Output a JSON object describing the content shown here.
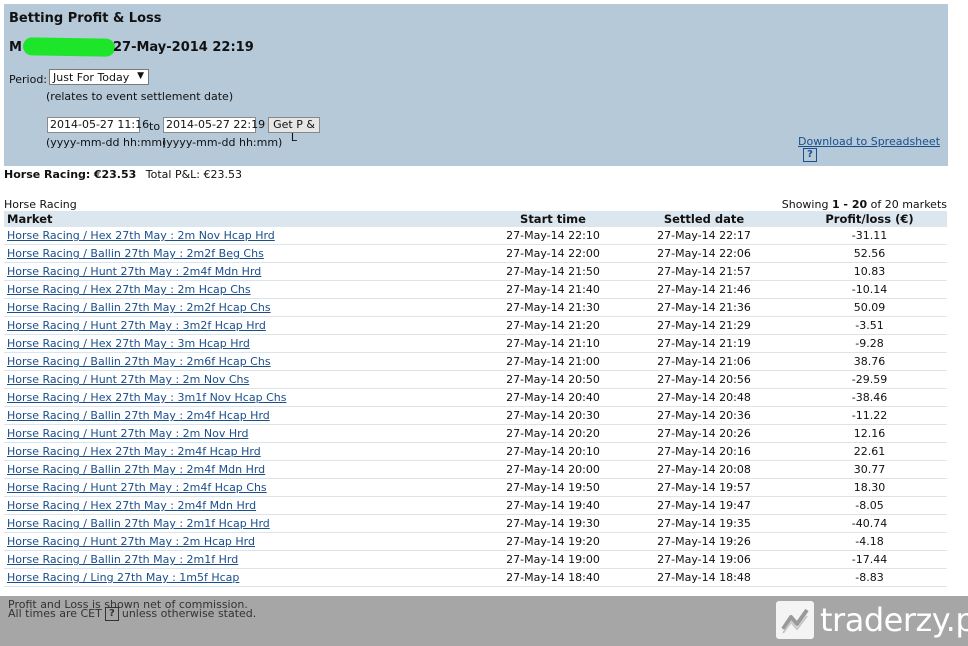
{
  "header": {
    "title": "Betting Profit & Loss",
    "account_prefix": "M",
    "account_timestamp": "27-May-2014 22:19",
    "period_label": "Period:",
    "period_value": "Just For Today",
    "period_note": "(relates to event settlement date)",
    "date_from": "2014-05-27 11:16",
    "to_label": "to",
    "date_to": "2014-05-27 22:19",
    "get_button": "Get P & L",
    "format_hint_from": "(yyyy-mm-dd hh:mm)",
    "format_hint_to": "(yyyy-mm-dd hh:mm)",
    "download_link": "Download to Spreadsheet",
    "help_mark": "?"
  },
  "summary": {
    "sport_label": "Horse Racing:",
    "sport_amount": "€23.53",
    "total_label": "Total P&L:",
    "total_amount": "€23.53"
  },
  "list": {
    "section": "Horse Racing",
    "showing_prefix": "Showing",
    "showing_range": "1 - 20",
    "showing_suffix": "of 20 markets",
    "columns": [
      "Market",
      "Start time",
      "Settled date",
      "Profit/loss (€)"
    ],
    "rows": [
      {
        "market": "Horse Racing / Hex 27th May : 2m Nov Hcap Hrd",
        "start": "27-May-14 22:10",
        "settled": "27-May-14 22:17",
        "pl": "-31.11"
      },
      {
        "market": "Horse Racing / Ballin 27th May : 2m2f Beg Chs",
        "start": "27-May-14 22:00",
        "settled": "27-May-14 22:06",
        "pl": "52.56"
      },
      {
        "market": "Horse Racing / Hunt 27th May : 2m4f Mdn Hrd",
        "start": "27-May-14 21:50",
        "settled": "27-May-14 21:57",
        "pl": "10.83"
      },
      {
        "market": "Horse Racing / Hex 27th May : 2m Hcap Chs",
        "start": "27-May-14 21:40",
        "settled": "27-May-14 21:46",
        "pl": "-10.14"
      },
      {
        "market": "Horse Racing / Ballin 27th May : 2m2f Hcap Chs",
        "start": "27-May-14 21:30",
        "settled": "27-May-14 21:36",
        "pl": "50.09"
      },
      {
        "market": "Horse Racing / Hunt 27th May : 3m2f Hcap Hrd",
        "start": "27-May-14 21:20",
        "settled": "27-May-14 21:29",
        "pl": "-3.51"
      },
      {
        "market": "Horse Racing / Hex 27th May : 3m Hcap Hrd",
        "start": "27-May-14 21:10",
        "settled": "27-May-14 21:19",
        "pl": "-9.28"
      },
      {
        "market": "Horse Racing / Ballin 27th May : 2m6f Hcap Chs",
        "start": "27-May-14 21:00",
        "settled": "27-May-14 21:06",
        "pl": "38.76"
      },
      {
        "market": "Horse Racing / Hunt 27th May : 2m Nov Chs",
        "start": "27-May-14 20:50",
        "settled": "27-May-14 20:56",
        "pl": "-29.59"
      },
      {
        "market": "Horse Racing / Hex 27th May : 3m1f Nov Hcap Chs",
        "start": "27-May-14 20:40",
        "settled": "27-May-14 20:48",
        "pl": "-38.46"
      },
      {
        "market": "Horse Racing / Ballin 27th May : 2m4f Hcap Hrd",
        "start": "27-May-14 20:30",
        "settled": "27-May-14 20:36",
        "pl": "-11.22"
      },
      {
        "market": "Horse Racing / Hunt 27th May : 2m Nov Hrd",
        "start": "27-May-14 20:20",
        "settled": "27-May-14 20:26",
        "pl": "12.16"
      },
      {
        "market": "Horse Racing / Hex 27th May : 2m4f Hcap Hrd",
        "start": "27-May-14 20:10",
        "settled": "27-May-14 20:16",
        "pl": "22.61"
      },
      {
        "market": "Horse Racing / Ballin 27th May : 2m4f Mdn Hrd",
        "start": "27-May-14 20:00",
        "settled": "27-May-14 20:08",
        "pl": "30.77"
      },
      {
        "market": "Horse Racing / Hunt 27th May : 2m4f Hcap Chs",
        "start": "27-May-14 19:50",
        "settled": "27-May-14 19:57",
        "pl": "18.30"
      },
      {
        "market": "Horse Racing / Hex 27th May : 2m4f Mdn Hrd",
        "start": "27-May-14 19:40",
        "settled": "27-May-14 19:47",
        "pl": "-8.05"
      },
      {
        "market": "Horse Racing / Ballin 27th May : 2m1f Hcap Hrd",
        "start": "27-May-14 19:30",
        "settled": "27-May-14 19:35",
        "pl": "-40.74"
      },
      {
        "market": "Horse Racing / Hunt 27th May : 2m Hcap Hrd",
        "start": "27-May-14 19:20",
        "settled": "27-May-14 19:26",
        "pl": "-4.18"
      },
      {
        "market": "Horse Racing / Ballin 27th May : 2m1f Hrd",
        "start": "27-May-14 19:00",
        "settled": "27-May-14 19:06",
        "pl": "-17.44"
      },
      {
        "market": "Horse Racing / Ling 27th May : 1m5f Hcap",
        "start": "27-May-14 18:40",
        "settled": "27-May-14 18:48",
        "pl": "-8.83"
      }
    ]
  },
  "footer": {
    "note1": "Profit and Loss is shown net of commission.",
    "note2_prefix": "All times are CET",
    "note2_suffix": "unless otherwise stated."
  },
  "watermark": {
    "name": "traderzy.pl",
    "icon": "chart-zigzag-icon"
  },
  "colors": {
    "header_bg": "#b5c9d9",
    "table_header_bg": "#dbe6ee",
    "link": "#1a4f8c",
    "redaction": "#1de62a"
  }
}
